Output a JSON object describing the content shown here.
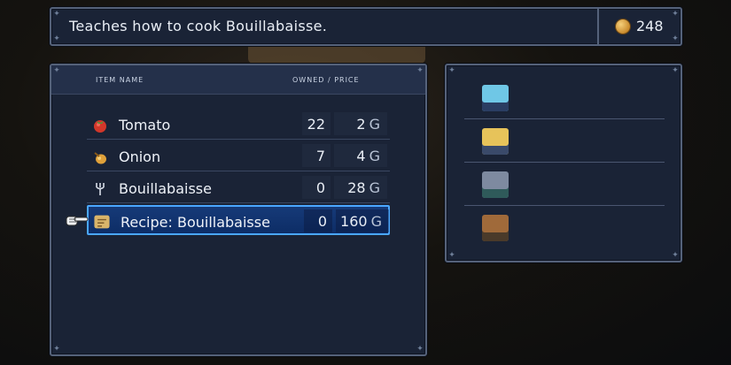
{
  "description": {
    "text": "Teaches how to cook Bouillabaisse."
  },
  "gold": {
    "amount": "248",
    "icon": "gold-coin-icon"
  },
  "shop": {
    "header_name": "ITEM NAME",
    "header_owned_price": "OWNED / PRICE",
    "items": [
      {
        "name": "Tomato",
        "owned": "22",
        "price": "2",
        "currency": "G",
        "icon": "tomato-icon"
      },
      {
        "name": "Onion",
        "owned": "7",
        "price": "4",
        "currency": "G",
        "icon": "onion-icon"
      },
      {
        "name": "Bouillabaisse",
        "owned": "0",
        "price": "28",
        "currency": "G",
        "icon": "fork-icon"
      },
      {
        "name": "Recipe: Bouillabaisse",
        "owned": "0",
        "price": "160",
        "currency": "G",
        "icon": "scroll-icon",
        "selected": true
      }
    ]
  },
  "party": {
    "members": [
      {
        "portrait": "blue-haired-character-portrait",
        "color": "#6fc7e6"
      },
      {
        "portrait": "blonde-character-portrait",
        "color": "#e7c35a"
      },
      {
        "portrait": "gray-haired-character-portrait",
        "color": "#7e8aa0"
      },
      {
        "portrait": "brown-haired-character-portrait",
        "color": "#a06a3a"
      }
    ]
  },
  "colors": {
    "panel": "#1a2336",
    "selection": "#4aa7ff",
    "gold": "#e0a84a"
  }
}
